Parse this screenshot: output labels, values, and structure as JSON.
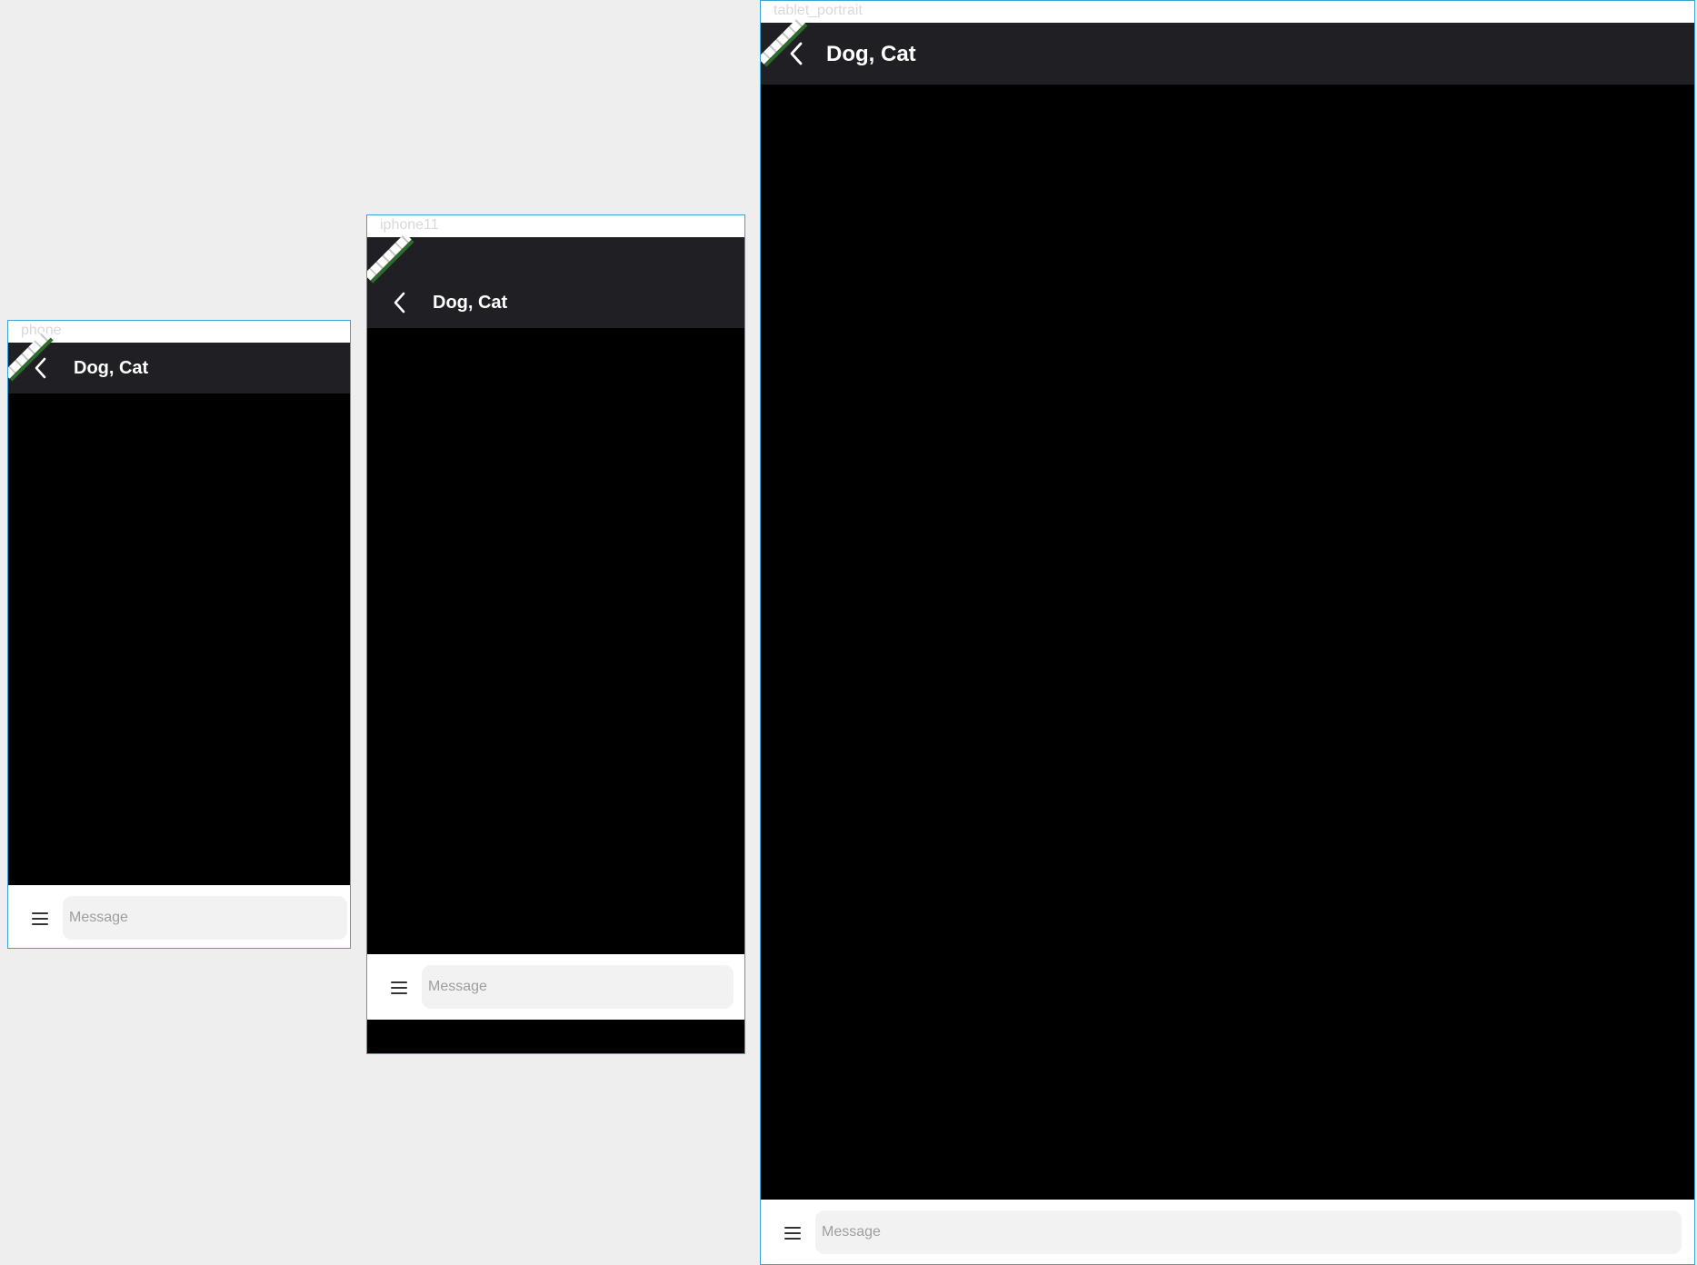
{
  "frames": [
    {
      "id": "phone",
      "label": "phone",
      "title": "Dog, Cat",
      "back_icon": "back-chevron-icon",
      "menu_icon": "menu-icon",
      "message_placeholder": "Message"
    },
    {
      "id": "iphone11",
      "label": "iphone11",
      "title": "Dog, Cat",
      "back_icon": "back-chevron-icon",
      "menu_icon": "menu-icon",
      "message_placeholder": "Message"
    },
    {
      "id": "tablet-portrait",
      "label": "tablet_portrait",
      "title": "Dog, Cat",
      "back_icon": "back-chevron-icon",
      "menu_icon": "menu-icon",
      "message_placeholder": "Message"
    }
  ],
  "colors": {
    "canvas_background": "#eeeeee",
    "frame_border": "#3aa3d8",
    "app_bar": "#202024",
    "content": "#000000",
    "composer": "#ffffff",
    "input_background": "#f2f2f2"
  }
}
